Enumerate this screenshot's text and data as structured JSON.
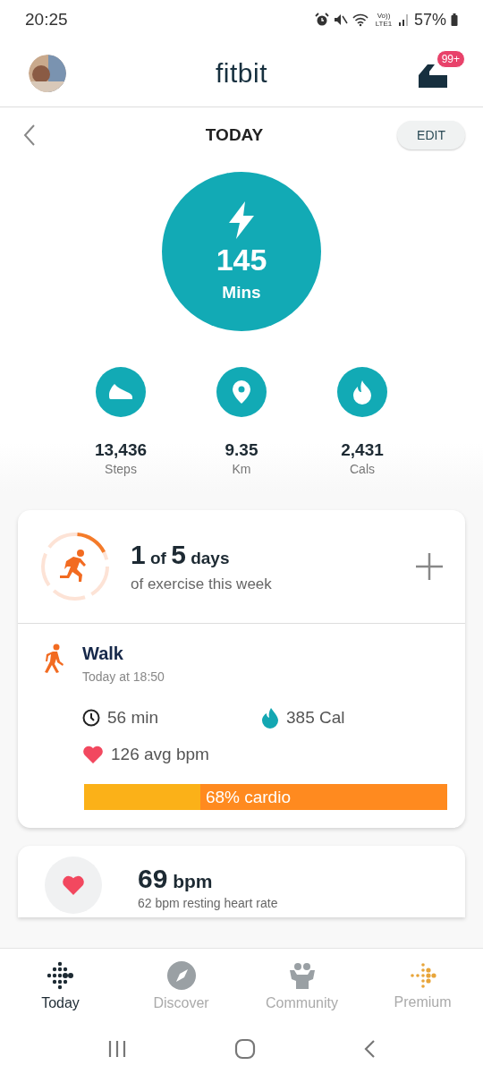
{
  "status_bar": {
    "time": "20:25",
    "network": "Vo)) LTE1",
    "battery": "57%"
  },
  "header": {
    "logo": "fitbit",
    "badge": "99+"
  },
  "day_bar": {
    "title": "TODAY",
    "edit": "EDIT"
  },
  "zone": {
    "value": "145",
    "unit": "Mins"
  },
  "stats": [
    {
      "kind": "steps",
      "value": "13,436",
      "unit": "Steps"
    },
    {
      "kind": "distance",
      "value": "9.35",
      "unit": "Km"
    },
    {
      "kind": "calories",
      "value": "2,431",
      "unit": "Cals"
    }
  ],
  "exercise_goal": {
    "done": "1",
    "of": "of",
    "goal": "5",
    "days": "days",
    "subtitle": "of exercise this week"
  },
  "activity": {
    "name": "Walk",
    "time": "Today at 18:50",
    "duration": "56 min",
    "calories": "385 Cal",
    "heart_rate": "126 avg bpm",
    "cardio": {
      "level": 0.68,
      "label": "68% cardio"
    }
  },
  "heart": {
    "value": "69",
    "unit": "bpm",
    "subtitle": "62 bpm resting heart rate"
  },
  "tabs": [
    {
      "kind": "today",
      "label": "Today",
      "selected": true
    },
    {
      "kind": "discover",
      "label": "Discover",
      "selected": false
    },
    {
      "kind": "community",
      "label": "Community",
      "selected": false
    },
    {
      "kind": "premium",
      "label": "Premium",
      "selected": false
    }
  ]
}
